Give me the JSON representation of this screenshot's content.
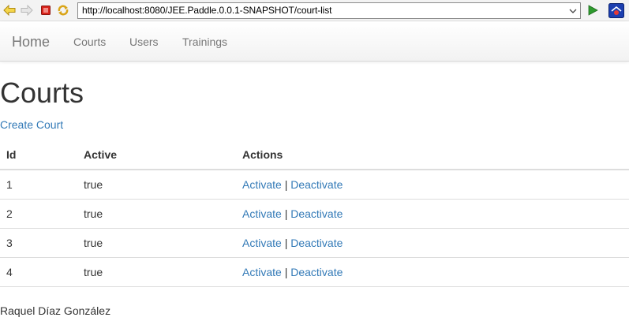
{
  "browser": {
    "url": "http://localhost:8080/JEE.Paddle.0.0.1-SNAPSHOT/court-list"
  },
  "navbar": {
    "brand": "Home",
    "links": [
      "Courts",
      "Users",
      "Trainings"
    ]
  },
  "page": {
    "title": "Courts",
    "create_link": "Create Court"
  },
  "table": {
    "headers": [
      "Id",
      "Active",
      "Actions"
    ],
    "rows": [
      {
        "id": "1",
        "active": "true",
        "activate": "Activate",
        "separator": "|",
        "deactivate": "Deactivate"
      },
      {
        "id": "2",
        "active": "true",
        "activate": "Activate",
        "separator": "|",
        "deactivate": "Deactivate"
      },
      {
        "id": "3",
        "active": "true",
        "activate": "Activate",
        "separator": "|",
        "deactivate": "Deactivate"
      },
      {
        "id": "4",
        "active": "true",
        "activate": "Activate",
        "separator": "|",
        "deactivate": "Deactivate"
      }
    ]
  },
  "footer": {
    "author": "Raquel Díaz González"
  },
  "colors": {
    "link": "#337ab7",
    "text": "#333333",
    "nav_text": "#777777",
    "stop_red": "#d9241c",
    "go_green": "#2e9a2e"
  },
  "icons": {
    "back": "back-arrow-icon",
    "forward": "forward-arrow-icon",
    "stop": "stop-icon",
    "refresh": "refresh-icon",
    "dropdown": "chevron-down-icon",
    "go": "play-icon",
    "app": "app-logo-icon"
  }
}
